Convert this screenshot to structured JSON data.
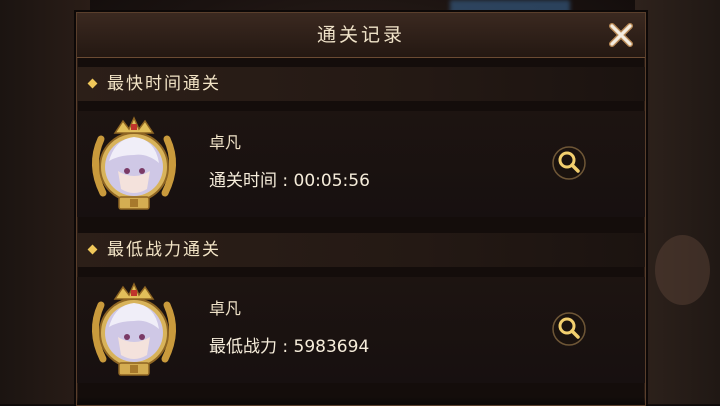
{
  "header": {
    "title": "通关记录"
  },
  "sections": [
    {
      "title": "最快时间通关",
      "record": {
        "player_name": "卓凡",
        "stat_label": "通关时间",
        "stat_value": "00:05:56"
      }
    },
    {
      "title": "最低战力通关",
      "record": {
        "player_name": "卓凡",
        "stat_label": "最低战力",
        "stat_value": "5983694"
      }
    }
  ],
  "icons": {
    "close": "close-icon",
    "view": "magnifier-icon",
    "avatar_frame": "laurel-crown-frame"
  },
  "colors": {
    "accent_gold": "#f0c85a",
    "text_light": "#efe2c8",
    "panel_bg": "#140d0b"
  }
}
